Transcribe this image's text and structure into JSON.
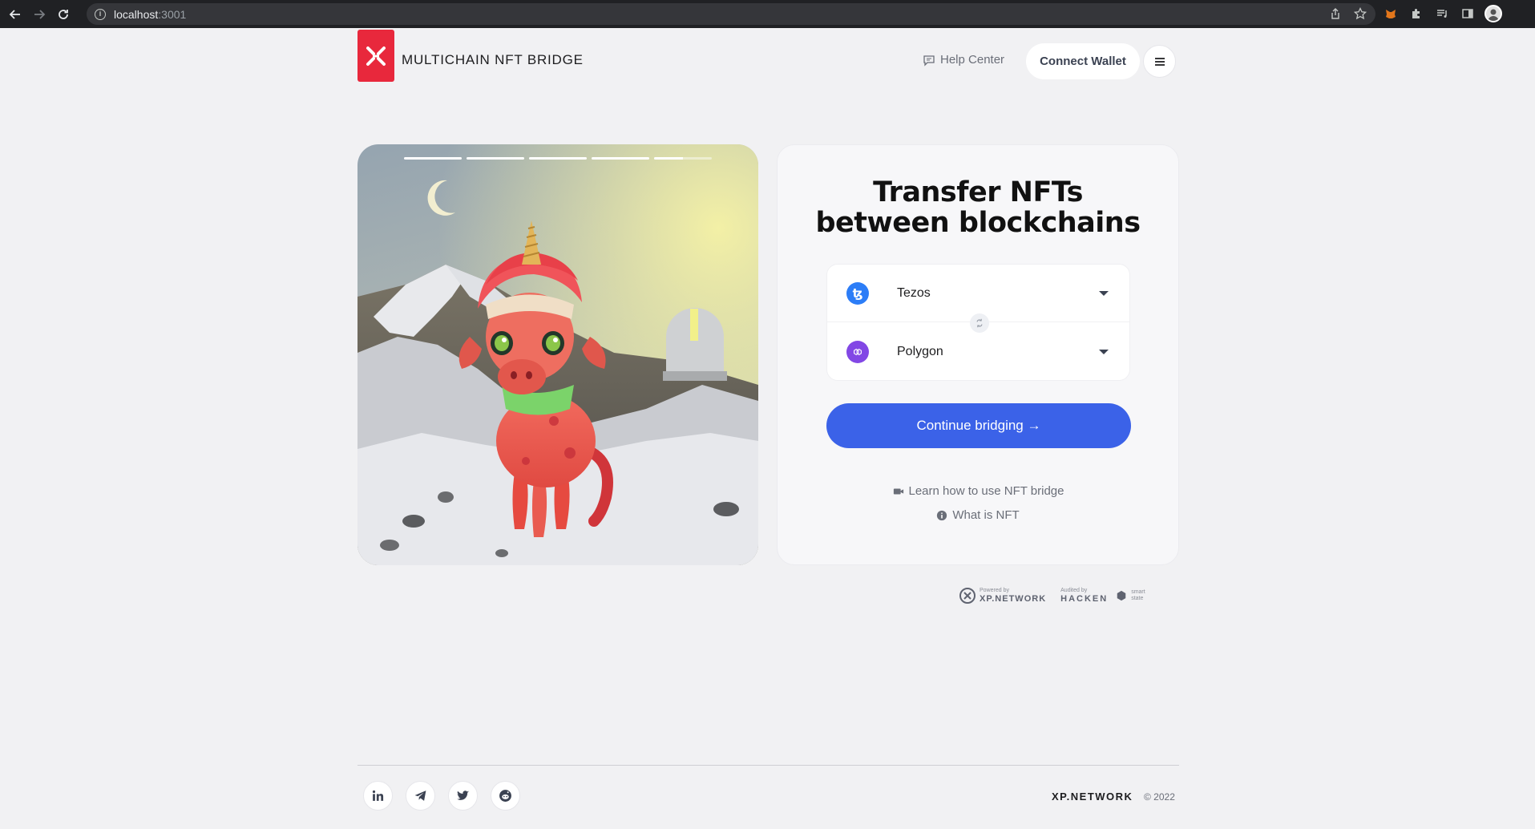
{
  "browser": {
    "url_host": "localhost",
    "url_port": ":3001"
  },
  "header": {
    "logo_text": "MULTICHAIN NFT BRIDGE",
    "help_center_label": "Help Center",
    "connect_wallet_label": "Connect Wallet"
  },
  "hero": {
    "slides_total": 5,
    "active_slide": 5,
    "active_slide_progress": 0.5
  },
  "card": {
    "title_line1": "Transfer NFTs",
    "title_line2": "between blockchains",
    "from_chain": {
      "name": "Tezos",
      "icon": "tezos-icon",
      "color": "#2c7df7"
    },
    "to_chain": {
      "name": "Polygon",
      "icon": "polygon-icon",
      "color": "#8247e5"
    },
    "continue_label": "Continue bridging →",
    "learn_label": "Learn how to use NFT bridge",
    "what_is_label": "What is NFT"
  },
  "powered": {
    "powered_by": "Powered by",
    "xp_brand": "XP.NETWORK",
    "audited_by": "Audited by",
    "hacken_brand": "HACKEN",
    "smart_state_line1": "smart",
    "smart_state_line2": "state"
  },
  "footer": {
    "social": [
      "linkedin-icon",
      "telegram-icon",
      "twitter-icon",
      "reddit-icon"
    ],
    "brand": "XP.NETWORK",
    "copyright": "© 2022"
  },
  "colors": {
    "accent": "#3b62e8",
    "logo_red": "#e8283c",
    "background": "#f1f1f3"
  }
}
